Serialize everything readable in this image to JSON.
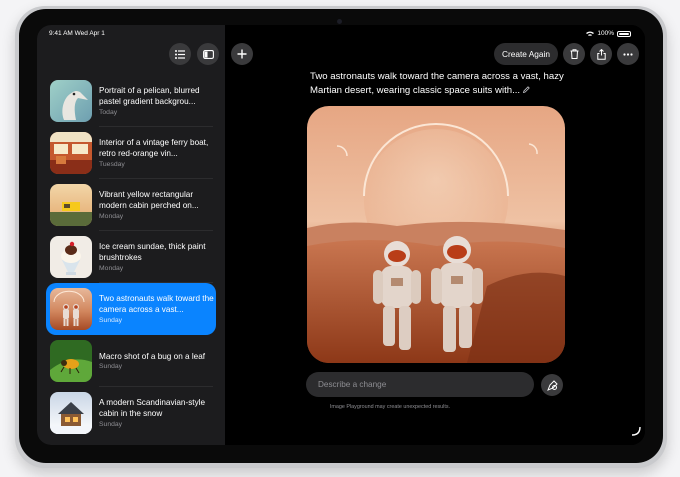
{
  "status_bar": {
    "time": "9:41 AM  Wed Apr 1",
    "battery": "100%"
  },
  "sidebar": {
    "items": [
      {
        "title": "Portrait of a pelican, blurred pastel gradient backgrou...",
        "date": "Today"
      },
      {
        "title": "Interior of a vintage ferry boat, retro red-orange vin...",
        "date": "Tuesday"
      },
      {
        "title": "Vibrant yellow rectangular modern cabin perched on...",
        "date": "Monday"
      },
      {
        "title": "Ice cream sundae, thick paint brushtrokes",
        "date": "Monday"
      },
      {
        "title": "Two astronauts walk toward the camera across a vast...",
        "date": "Sunday"
      },
      {
        "title": "Macro shot of a bug on a leaf",
        "date": "Sunday"
      },
      {
        "title": "A modern Scandinavian-style cabin in the snow",
        "date": "Sunday"
      }
    ],
    "selected_index": 4
  },
  "toolbar": {
    "create_again_label": "Create Again"
  },
  "prompt": {
    "text": "Two astronauts walk toward the camera across a vast, hazy Martian desert, wearing classic space suits with..."
  },
  "change_input": {
    "placeholder": "Describe a change"
  },
  "disclaimer": "Image Playground may create unexpected results.",
  "colors": {
    "accent": "#0a84ff",
    "sidebar_bg": "#1c1c1e",
    "control_bg": "#2c2c2e"
  },
  "icons": [
    "list-icon",
    "sidebar-icon",
    "plus-icon",
    "trash-icon",
    "share-icon",
    "ellipsis-icon",
    "pencil-icon",
    "edit-change-icon",
    "wifi-icon",
    "battery-icon"
  ]
}
